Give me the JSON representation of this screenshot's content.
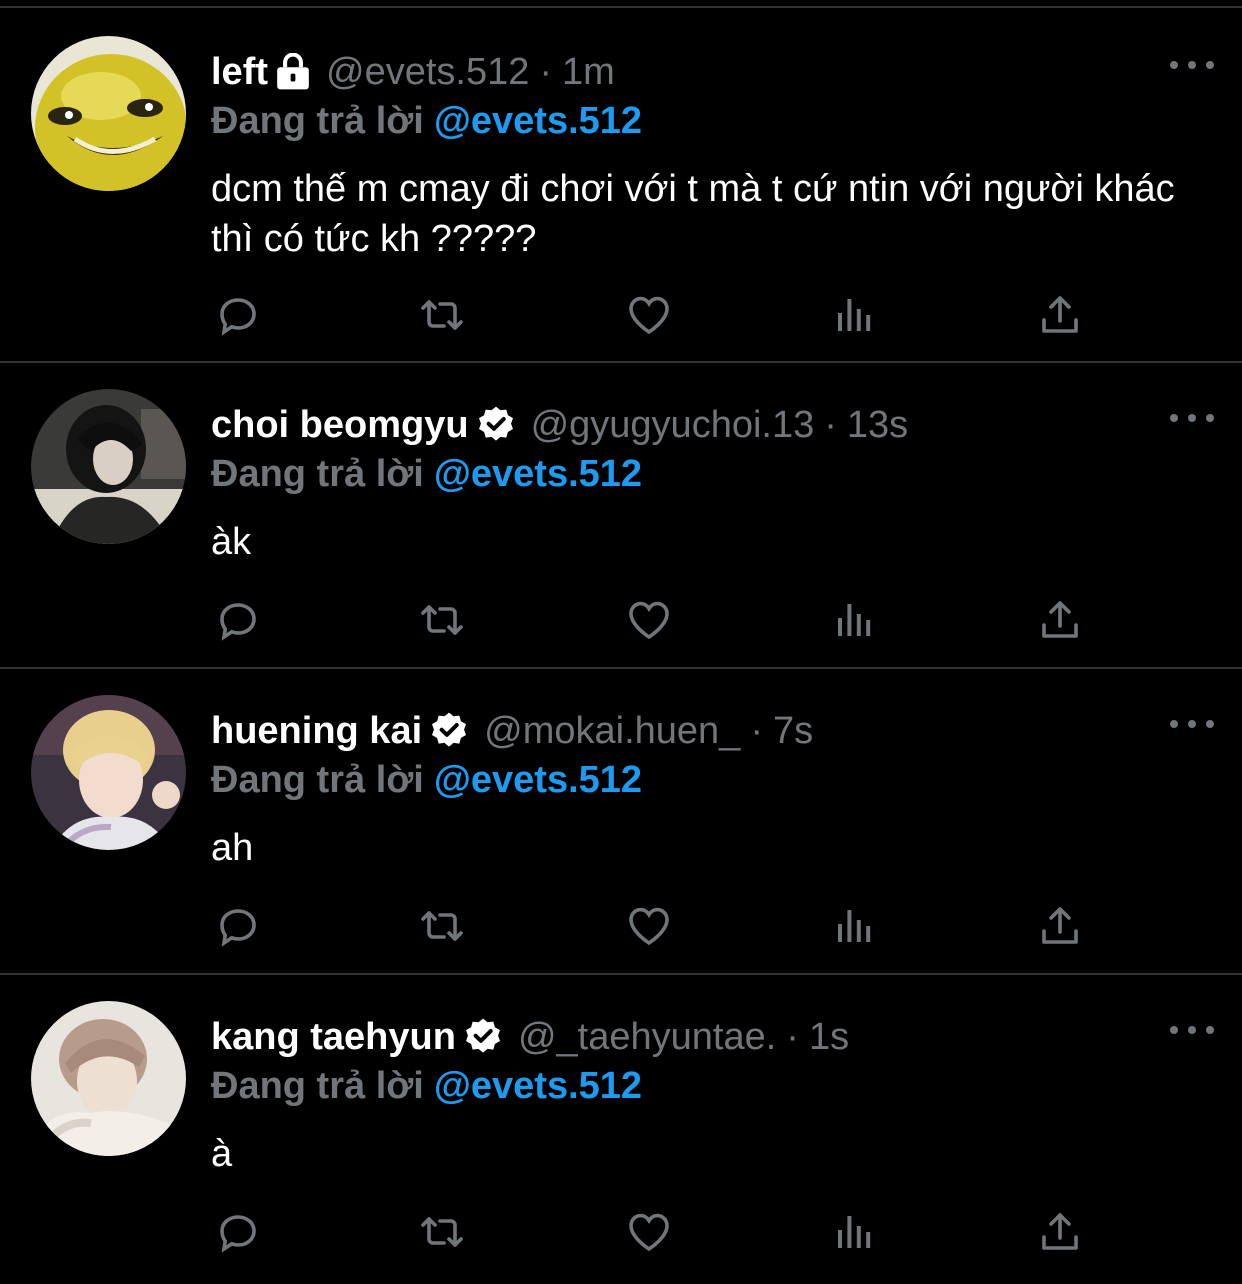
{
  "reply_prefix": "Đang trả lời",
  "tweets": [
    {
      "name": "left",
      "handle": "@evets.512",
      "time": "1m",
      "reply_to": "@evets.512",
      "text": "dcm thế m cmay đi chơi với t mà t cứ ntin với người khác thì có tức kh ?????",
      "badge": "lock-icon",
      "avatar": "yellow-smiley-face"
    },
    {
      "name": "choi beomgyu",
      "handle": "@gyugyuchoi.13",
      "time": "13s",
      "reply_to": "@evets.512",
      "text": "àk",
      "badge": "verified-icon",
      "avatar": "person-photo"
    },
    {
      "name": "huening kai",
      "handle": "@mokai.huen_",
      "time": "7s",
      "reply_to": "@evets.512",
      "text": "ah",
      "badge": "verified-icon",
      "avatar": "person-photo"
    },
    {
      "name": "kang taehyun",
      "handle": "@_taehyuntae.",
      "time": "1s",
      "reply_to": "@evets.512",
      "text": "à",
      "badge": "verified-icon",
      "avatar": "person-photo"
    }
  ],
  "actions": [
    "reply-icon",
    "retweet-icon",
    "like-icon",
    "analytics-icon",
    "share-icon"
  ],
  "colors": {
    "background": "#000000",
    "text": "#ffffff",
    "muted": "#71767b",
    "accent": "#1d9bf0",
    "divider": "#2f3336"
  }
}
